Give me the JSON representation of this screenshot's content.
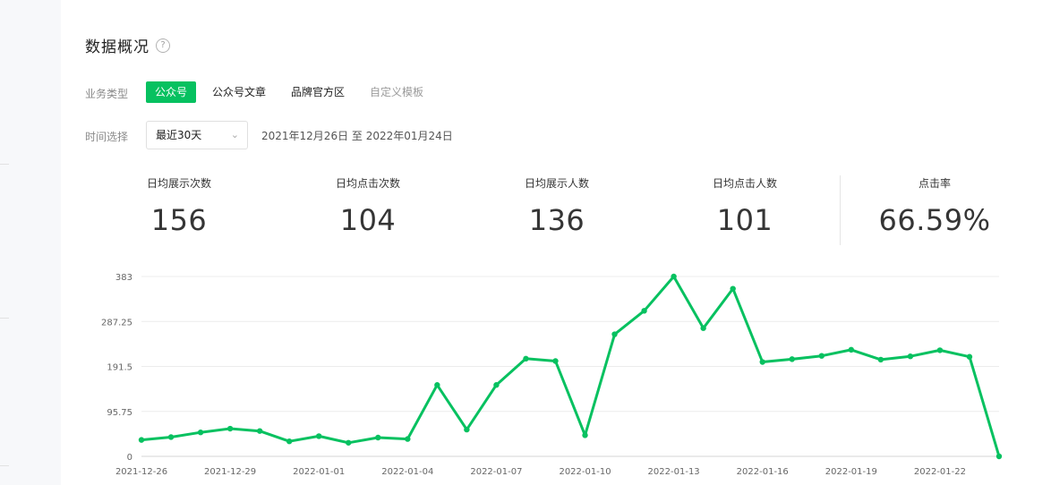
{
  "header": {
    "title": "数据概况",
    "help_icon": "?"
  },
  "filters": {
    "type_label": "业务类型",
    "types": [
      {
        "label": "公众号",
        "active": true
      },
      {
        "label": "公众号文章",
        "active": false
      },
      {
        "label": "品牌官方区",
        "active": false
      },
      {
        "label": "自定义模板",
        "active": false,
        "muted": true
      }
    ],
    "time_label": "时间选择",
    "time_select": "最近30天",
    "date_range": "2021年12月26日 至 2022年01月24日"
  },
  "metrics": [
    {
      "label": "日均展示次数",
      "value": "156"
    },
    {
      "label": "日均点击次数",
      "value": "104"
    },
    {
      "label": "日均展示人数",
      "value": "136"
    },
    {
      "label": "日均点击人数",
      "value": "101"
    },
    {
      "label": "点击率",
      "value": "66.59%"
    }
  ],
  "chart_data": {
    "type": "line",
    "color": "#07c160",
    "y_ticks": [
      "0",
      "95.75",
      "191.5",
      "287.25",
      "383"
    ],
    "ylim": [
      0,
      383
    ],
    "x_tick_labels": [
      "2021-12-26",
      "2021-12-29",
      "2022-01-01",
      "2022-01-04",
      "2022-01-07",
      "2022-01-10",
      "2022-01-13",
      "2022-01-16",
      "2022-01-19",
      "2022-01-22"
    ],
    "x": [
      "2021-12-26",
      "2021-12-27",
      "2021-12-28",
      "2021-12-29",
      "2021-12-30",
      "2021-12-31",
      "2022-01-01",
      "2022-01-02",
      "2022-01-03",
      "2022-01-04",
      "2022-01-05",
      "2022-01-06",
      "2022-01-07",
      "2022-01-08",
      "2022-01-09",
      "2022-01-10",
      "2022-01-11",
      "2022-01-12",
      "2022-01-13",
      "2022-01-14",
      "2022-01-15",
      "2022-01-16",
      "2022-01-17",
      "2022-01-18",
      "2022-01-19",
      "2022-01-20",
      "2022-01-21",
      "2022-01-22",
      "2022-01-23",
      "2022-01-24"
    ],
    "values": [
      35,
      41,
      51,
      59,
      54,
      32,
      43,
      29,
      40,
      37,
      152,
      57,
      152,
      208,
      203,
      45,
      260,
      310,
      383,
      273,
      357,
      201,
      207,
      214,
      227,
      206,
      213,
      226,
      212,
      0
    ],
    "grid": true
  }
}
